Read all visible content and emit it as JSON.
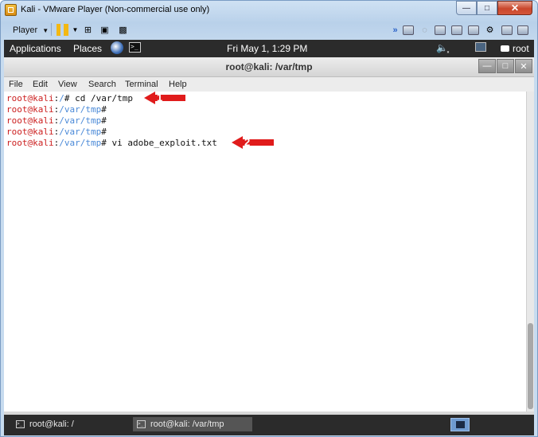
{
  "window": {
    "title": "Kali - VMware Player (Non-commercial use only)"
  },
  "vm_toolbar": {
    "player_label": "Player"
  },
  "gnome": {
    "applications": "Applications",
    "places": "Places",
    "clock": "Fri May  1,  1:29 PM",
    "user": "root"
  },
  "terminal": {
    "title": "root@kali: /var/tmp",
    "menu": [
      "File",
      "Edit",
      "View",
      "Search",
      "Terminal",
      "Help"
    ],
    "lines": [
      {
        "user": "root@kali",
        "sep": ":",
        "path": "/",
        "prompt": "# ",
        "cmd": "cd /var/tmp"
      },
      {
        "user": "root@kali",
        "sep": ":",
        "path": "/var/tmp",
        "prompt": "#",
        "cmd": ""
      },
      {
        "user": "root@kali",
        "sep": ":",
        "path": "/var/tmp",
        "prompt": "#",
        "cmd": ""
      },
      {
        "user": "root@kali",
        "sep": ":",
        "path": "/var/tmp",
        "prompt": "#",
        "cmd": ""
      },
      {
        "user": "root@kali",
        "sep": ":",
        "path": "/var/tmp",
        "prompt": "# ",
        "cmd": "vi adobe_exploit.txt"
      }
    ],
    "annotations": [
      "1",
      "2"
    ],
    "annotation_color": "#e01b1b"
  },
  "taskbar": {
    "tasks": [
      {
        "label": "root@kali: /"
      },
      {
        "label": "root@kali: /var/tmp"
      }
    ]
  },
  "colors": {
    "user": "#cc2020",
    "path": "#4b8ad8",
    "panel": "#2b2b2b"
  }
}
